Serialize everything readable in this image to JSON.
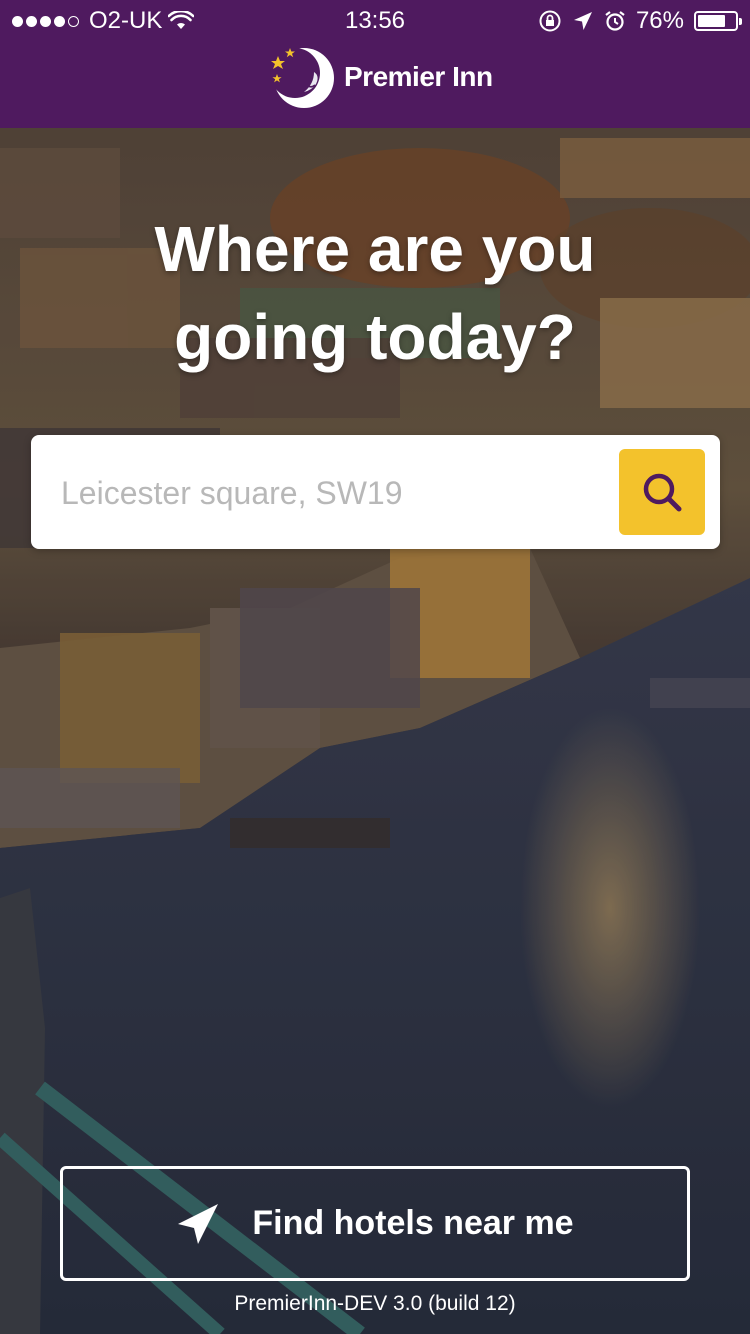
{
  "status_bar": {
    "carrier": "O2-UK",
    "time": "13:56",
    "battery": "76%",
    "battery_level": 0.76,
    "signal_bars_filled": 4,
    "signal_bars_total": 5
  },
  "header": {
    "brand": "Premier Inn",
    "color": "#4f1a5f"
  },
  "hero": {
    "headline_line1": "Where are you",
    "headline_line2": "going today?"
  },
  "search": {
    "placeholder": "Leicester square, SW19",
    "button_icon": "search-icon",
    "button_color": "#f3c22c"
  },
  "actions": {
    "find_nearby_label": "Find hotels near me",
    "find_nearby_icon": "location-arrow-icon"
  },
  "footer": {
    "build_info": "PremierInn-DEV 3.0 (build 12)"
  }
}
